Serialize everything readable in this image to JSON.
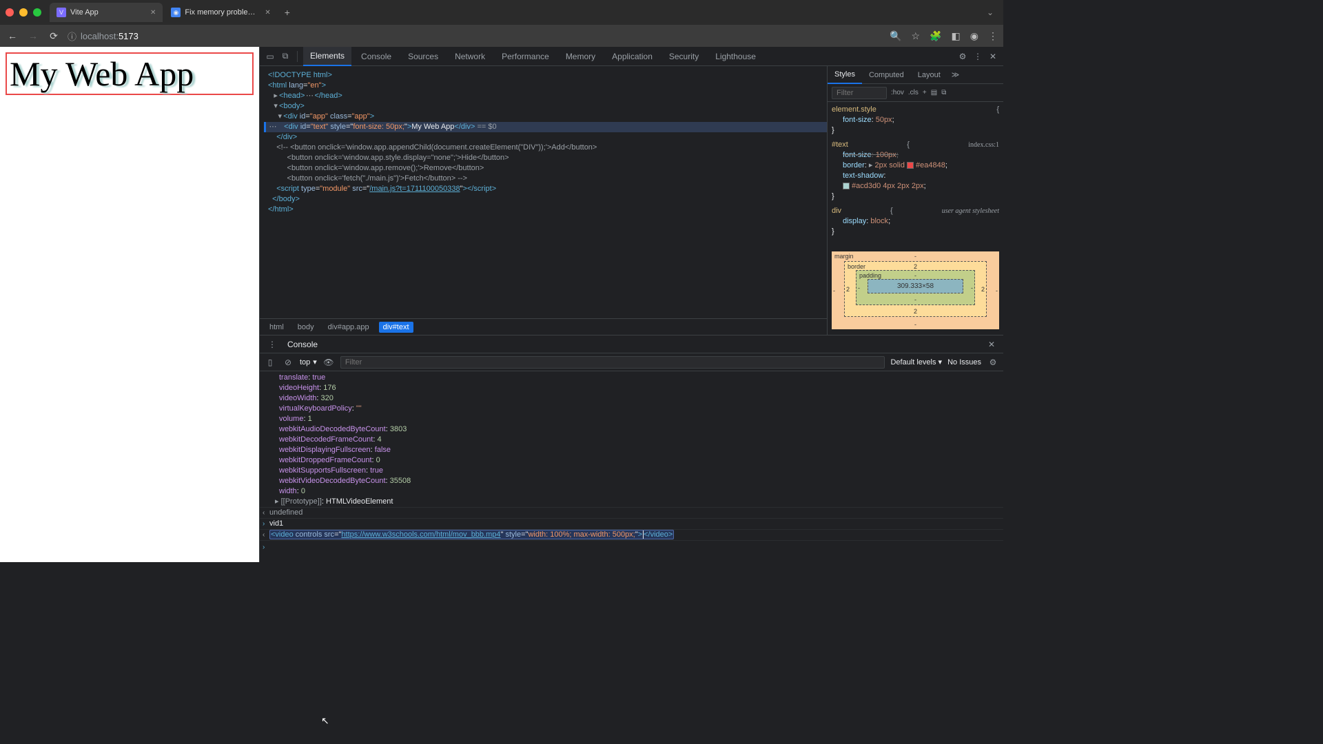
{
  "tabs": [
    {
      "title": "Vite App",
      "favicon": "V"
    },
    {
      "title": "Fix memory problems | Dev",
      "favicon": "◉"
    }
  ],
  "url_host": "localhost:",
  "url_port": "5173",
  "page_text": "My Web App",
  "devtools": {
    "tabs": [
      "Elements",
      "Console",
      "Sources",
      "Network",
      "Performance",
      "Memory",
      "Application",
      "Security",
      "Lighthouse"
    ],
    "active_tab": "Elements"
  },
  "dom": {
    "doctype": "<!DOCTYPE html>",
    "html_open": "<html lang=\"en\">",
    "head": "<head>…</head>",
    "body_open": "<body>",
    "app_open": "<div id=\"app\" class=\"app\">",
    "text_div": {
      "open": "<div id=\"text\" style=\"",
      "style": "font-size: 50px;",
      "mid": "\">",
      "content": "My Web App",
      "close": "</div>",
      "after": " == $0"
    },
    "app_close": "</div>",
    "comment_lines": [
      "<!-- <button onclick='window.app.appendChild(document.createElement(\"DIV\"));'>Add</button>",
      "     <button onclick='window.app.style.display=\"none\";'>Hide</button>",
      "     <button onclick='window.app.remove();'>Remove</button>",
      "     <button onclick='fetch(\"./main.js\")'>Fetch</button> -->"
    ],
    "script": {
      "pre": "<script type=\"module\" src=\"",
      "src": "/main.js?t=1711100050338",
      "post": "\"></script>"
    },
    "body_close": "</body>",
    "html_close": "</html>",
    "breadcrumbs": [
      "html",
      "body",
      "div#app.app",
      "div#text"
    ]
  },
  "styles": {
    "tabs": [
      "Styles",
      "Computed",
      "Layout"
    ],
    "filter_placeholder": "Filter",
    "chips": [
      ":hov",
      ".cls",
      "+"
    ],
    "rules": [
      {
        "selector": "element.style",
        "props": [
          {
            "n": "font-size",
            "v": "50px"
          }
        ]
      },
      {
        "selector": "#text",
        "source": "index.css:1",
        "props": [
          {
            "n": "font-size",
            "v": "100px",
            "struck": true
          },
          {
            "n": "border",
            "v": "2px solid",
            "swatch": "#ea4848",
            "tail": "#ea4848"
          },
          {
            "n": "text-shadow",
            "v": ""
          },
          {
            "n": "",
            "v": "",
            "swatch": "#acd3d0",
            "tail": "#acd3d0 4px 2px 2px"
          }
        ]
      },
      {
        "selector": "div",
        "source": "user agent stylesheet",
        "props": [
          {
            "n": "display",
            "v": "block"
          }
        ]
      }
    ],
    "box_model": {
      "margin": {
        "t": "-",
        "r": "-",
        "b": "-",
        "l": "-"
      },
      "border": {
        "t": "2",
        "r": "2",
        "b": "2",
        "l": "2"
      },
      "padding": {
        "t": "-",
        "r": "-",
        "b": "-",
        "l": "-"
      },
      "content": "309.333×58"
    }
  },
  "console": {
    "tab_label": "Console",
    "context": "top",
    "filter_placeholder": "Filter",
    "levels_label": "Default levels",
    "issues_label": "No Issues",
    "object_lines": [
      {
        "k": "translate",
        "v": "true",
        "t": "bool"
      },
      {
        "k": "videoHeight",
        "v": "176",
        "t": "num"
      },
      {
        "k": "videoWidth",
        "v": "320",
        "t": "num"
      },
      {
        "k": "virtualKeyboardPolicy",
        "v": "\"\"",
        "t": "str"
      },
      {
        "k": "volume",
        "v": "1",
        "t": "num"
      },
      {
        "k": "webkitAudioDecodedByteCount",
        "v": "3803",
        "t": "num"
      },
      {
        "k": "webkitDecodedFrameCount",
        "v": "4",
        "t": "num"
      },
      {
        "k": "webkitDisplayingFullscreen",
        "v": "false",
        "t": "bool"
      },
      {
        "k": "webkitDroppedFrameCount",
        "v": "0",
        "t": "num"
      },
      {
        "k": "webkitSupportsFullscreen",
        "v": "true",
        "t": "bool"
      },
      {
        "k": "webkitVideoDecodedByteCount",
        "v": "35508",
        "t": "num"
      },
      {
        "k": "width",
        "v": "0",
        "t": "num"
      }
    ],
    "prototype_label": "[[Prototype]]",
    "prototype_value": "HTMLVideoElement",
    "undefined_label": "undefined",
    "prev_input_label": "vid1",
    "element_result": {
      "open": "<video controls src=\"",
      "src": "https://www.w3schools.com/html/mov_bbb.mp4",
      "mid": "\" style=\"",
      "style": "width: 100%; max-width: 500px;",
      "close": "\">",
      "end": "</video>"
    }
  }
}
